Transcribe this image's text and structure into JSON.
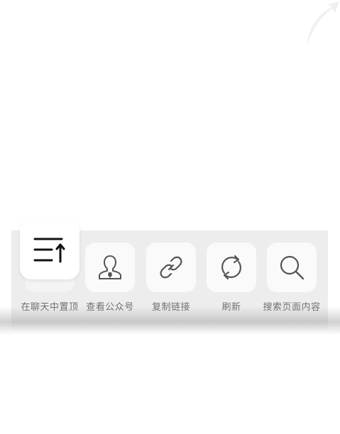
{
  "actions": [
    {
      "label": "在聊天中置顶",
      "icon": "pin-to-top-icon"
    },
    {
      "label": "查看公众号",
      "icon": "official-account-icon"
    },
    {
      "label": "复制链接",
      "icon": "link-icon"
    },
    {
      "label": "刷新",
      "icon": "refresh-icon"
    },
    {
      "label": "搜索页面内容",
      "icon": "search-icon"
    }
  ],
  "colors": {
    "panel_background": "#ededed",
    "tile_background": "#fafafa",
    "label_text": "#6f6f6f",
    "icon_stroke": "#555555"
  }
}
